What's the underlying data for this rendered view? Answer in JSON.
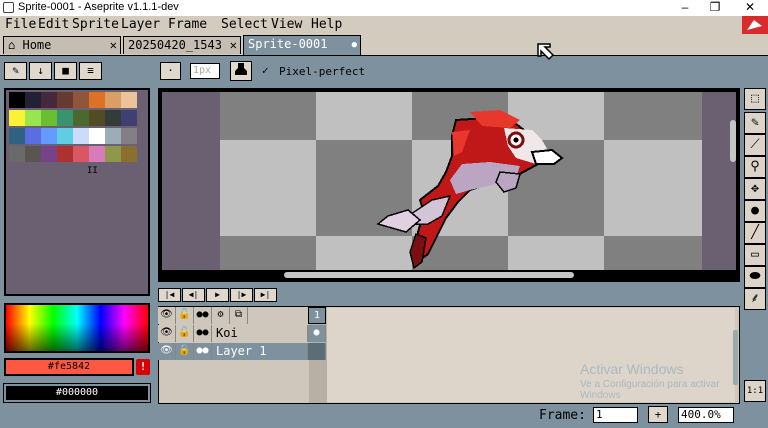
{
  "window": {
    "title": "Sprite-0001 - Aseprite v1.1.1-dev",
    "min": "–",
    "max": "❐",
    "close": "✕"
  },
  "menu": [
    "File",
    "Edit",
    "Sprite",
    "Layer",
    "Frame",
    "Select",
    "View",
    "Help"
  ],
  "tabs": [
    {
      "label": "Home",
      "icon": "home-icon",
      "close": "✕"
    },
    {
      "label": "20250420_1543",
      "close": "✕"
    },
    {
      "label": "Sprite-0001",
      "modified": "●"
    }
  ],
  "toolbar": {
    "brush_size": "1px",
    "pixel_perfect": "Pixel-perfect",
    "check": "✓"
  },
  "palette_buttons": [
    "✎",
    "↓",
    "■",
    "≡"
  ],
  "palette_colors": [
    "#000000",
    "#222034",
    "#45283c",
    "#663931",
    "#8f563b",
    "#df7126",
    "#d9a066",
    "#eec39a",
    "#fbf236",
    "#99e550",
    "#6abe30",
    "#37946e",
    "#4b692f",
    "#524b24",
    "#323c39",
    "#3f3f74",
    "#306082",
    "#5b6ee1",
    "#639bff",
    "#5fcde4",
    "#cbdbfc",
    "#ffffff",
    "#9badb7",
    "#847e87",
    "#696a6a",
    "#595652",
    "#76428a",
    "#ac3232",
    "#d95763",
    "#d77bba",
    "#8f974a",
    "#8a6f30"
  ],
  "colors": {
    "foreground": "#fe5842",
    "background": "#000000",
    "fg_label": "#fe5842",
    "bg_label": "#000000"
  },
  "layers": [
    {
      "name": "",
      "frame": "1",
      "header": true
    },
    {
      "name": "Koi",
      "cel": "●"
    },
    {
      "name": "Layer 1",
      "cel": "",
      "selected": true
    }
  ],
  "timeline_buttons": [
    "|◀",
    "◀|",
    "▶",
    "|▶",
    "▶|"
  ],
  "frame": {
    "label": "Frame:",
    "value": "1",
    "add": "+",
    "zoom": "400.0%"
  },
  "watermark": {
    "line1": "Activar Windows",
    "line2": "Ve a Configuración para activar",
    "line3": "Windows"
  },
  "tools": [
    "marquee-icon",
    "pencil-icon",
    "eyedropper-icon",
    "zoom-icon",
    "move-icon",
    "fill-icon",
    "line-icon",
    "rectangle-icon",
    "ellipse-icon",
    "blur-icon"
  ],
  "ratio": "1:1"
}
